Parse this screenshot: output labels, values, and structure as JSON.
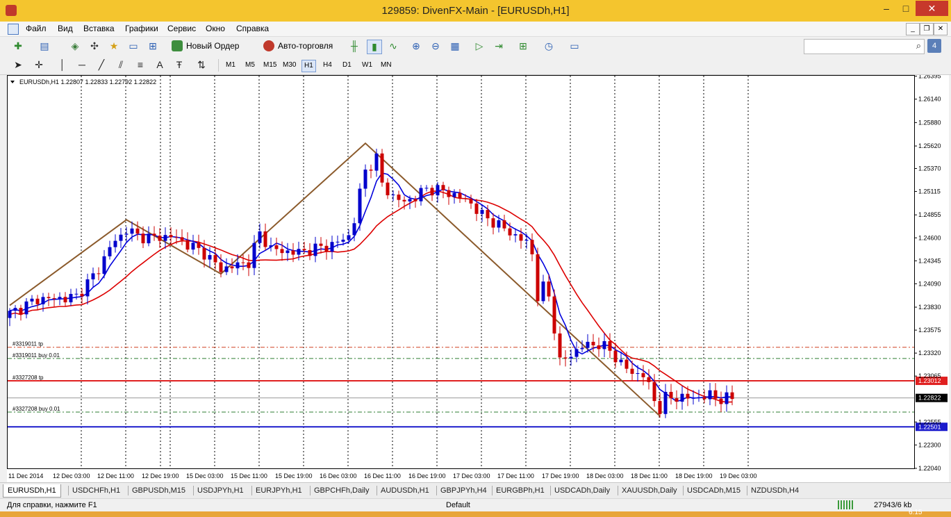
{
  "window": {
    "title": "129859: DivenFX-Main - [EURUSDh,H1]",
    "controls": [
      "–",
      "□",
      "✕"
    ]
  },
  "menu": {
    "items": [
      "Файл",
      "Вид",
      "Вставка",
      "Графики",
      "Сервис",
      "Окно",
      "Справка"
    ]
  },
  "toolbar": {
    "new_order_label": "Новый Ордер",
    "autotrade_label": "Авто-торговля",
    "search_placeholder": "",
    "notification_count": "4"
  },
  "timeframes": [
    "M1",
    "M5",
    "M15",
    "M30",
    "H1",
    "H4",
    "D1",
    "W1",
    "MN"
  ],
  "active_timeframe": "H1",
  "chart": {
    "header": "EURUSDh,H1  1.22807 1.22833 1.22792 1.22822",
    "price_labels": [
      "1.26395",
      "1.26140",
      "1.25880",
      "1.25620",
      "1.25370",
      "1.25115",
      "1.24855",
      "1.24600",
      "1.24345",
      "1.24090",
      "1.23830",
      "1.23575",
      "1.23320",
      "1.23065",
      "1.22555",
      "1.22300",
      "1.22040"
    ],
    "time_labels": [
      "11 Dec 2014",
      "12 Dec 03:00",
      "12 Dec 11:00",
      "12 Dec 19:00",
      "15 Dec 03:00",
      "15 Dec 11:00",
      "15 Dec 19:00",
      "16 Dec 03:00",
      "16 Dec 11:00",
      "16 Dec 19:00",
      "17 Dec 03:00",
      "17 Dec 11:00",
      "17 Dec 19:00",
      "18 Dec 03:00",
      "18 Dec 11:00",
      "18 Dec 19:00",
      "19 Dec 03:00"
    ],
    "order_labels": [
      "#3319011 tp",
      "#3319011 buy 0.01",
      "#3327208 tp",
      "#3327208 buy 0.01"
    ],
    "level_red": "1.23012",
    "level_current": "1.22822",
    "level_blue": "1.22501",
    "colors": {
      "bull": "#0000cc",
      "bear": "#cc0000",
      "zigzag": "#8b5a2b",
      "ma_fast": "#0000dd",
      "ma_slow": "#dd0000"
    }
  },
  "chart_data": {
    "type": "candlestick",
    "symbol": "EURUSDh",
    "timeframe": "H1",
    "ylim": [
      1.2204,
      1.264
    ],
    "zigzag_points": [
      [
        0,
        1.2385
      ],
      [
        21,
        1.248
      ],
      [
        38,
        1.242
      ],
      [
        64,
        1.2565
      ],
      [
        117,
        1.2262
      ]
    ],
    "levels": [
      1.23385,
      1.2326,
      1.23012,
      1.22822,
      1.22665,
      1.22501
    ],
    "ohlc_keypoints": [
      [
        0,
        1.2376
      ],
      [
        5,
        1.2392
      ],
      [
        10,
        1.2393
      ],
      [
        12,
        1.2395
      ],
      [
        14,
        1.241
      ],
      [
        16,
        1.2425
      ],
      [
        18,
        1.245
      ],
      [
        20,
        1.2462
      ],
      [
        21,
        1.247
      ],
      [
        23,
        1.2462
      ],
      [
        26,
        1.246
      ],
      [
        29,
        1.2462
      ],
      [
        32,
        1.2453
      ],
      [
        35,
        1.2443
      ],
      [
        38,
        1.2425
      ],
      [
        41,
        1.243
      ],
      [
        43,
        1.2433
      ],
      [
        45,
        1.2465
      ],
      [
        47,
        1.2448
      ],
      [
        49,
        1.2445
      ],
      [
        52,
        1.2444
      ],
      [
        55,
        1.2448
      ],
      [
        58,
        1.2452
      ],
      [
        61,
        1.2462
      ],
      [
        62,
        1.248
      ],
      [
        63,
        1.251
      ],
      [
        64,
        1.2535
      ],
      [
        66,
        1.2548
      ],
      [
        67,
        1.252
      ],
      [
        69,
        1.2505
      ],
      [
        71,
        1.25
      ],
      [
        73,
        1.2505
      ],
      [
        75,
        1.2515
      ],
      [
        78,
        1.2512
      ],
      [
        81,
        1.2505
      ],
      [
        83,
        1.2498
      ],
      [
        85,
        1.2485
      ],
      [
        87,
        1.2478
      ],
      [
        89,
        1.247
      ],
      [
        91,
        1.2462
      ],
      [
        93,
        1.2455
      ],
      [
        94,
        1.2442
      ],
      [
        95,
        1.2395
      ],
      [
        96,
        1.2405
      ],
      [
        97,
        1.2395
      ],
      [
        98,
        1.236
      ],
      [
        99,
        1.2322
      ],
      [
        101,
        1.233
      ],
      [
        103,
        1.234
      ],
      [
        106,
        1.2342
      ],
      [
        108,
        1.2335
      ],
      [
        110,
        1.232
      ],
      [
        112,
        1.231
      ],
      [
        114,
        1.2308
      ],
      [
        115,
        1.2295
      ],
      [
        116,
        1.228
      ],
      [
        117,
        1.227
      ],
      [
        118,
        1.2282
      ],
      [
        120,
        1.2283
      ],
      [
        123,
        1.2282
      ],
      [
        126,
        1.2285
      ],
      [
        128,
        1.2281
      ],
      [
        130,
        1.2282
      ]
    ]
  },
  "tabs": [
    "EURUSDh,H1",
    "USDCHFh,H1",
    "GBPUSDh,M15",
    "USDJPYh,H1",
    "EURJPYh,H1",
    "GBPCHFh,Daily",
    "AUDUSDh,H1",
    "GBPJPYh,H4",
    "EURGBPh,H1",
    "USDCADh,Daily",
    "XAUUSDh,Daily",
    "USDCADh,M15",
    "NZDUSDh,H4"
  ],
  "status": {
    "help": "Для справки, нажмите F1",
    "profile": "Default",
    "traffic": "27943/6 kb"
  },
  "taskbar": {
    "clock": "6:15"
  }
}
